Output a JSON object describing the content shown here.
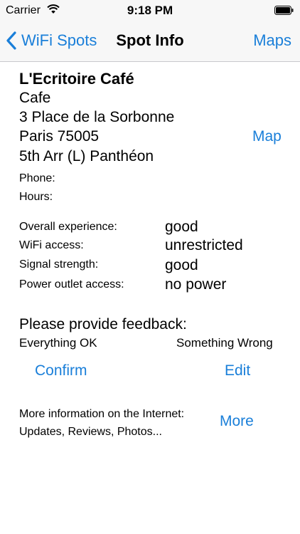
{
  "status_bar": {
    "carrier": "Carrier",
    "time": "9:18 PM"
  },
  "nav": {
    "back_label": "WiFi Spots",
    "title": "Spot Info",
    "right_label": "Maps"
  },
  "spot": {
    "name": "L'Ecritoire Café",
    "type": "Cafe",
    "street": "3 Place de la Sorbonne",
    "city": "Paris 75005",
    "district": " 5th Arr (L) Panthéon",
    "map_link": "Map",
    "phone_label": "Phone:",
    "hours_label": "Hours:"
  },
  "ratings": [
    {
      "label": "Overall experience:",
      "value": "good"
    },
    {
      "label": "WiFi access:",
      "value": "unrestricted"
    },
    {
      "label": "Signal strength:",
      "value": "good"
    },
    {
      "label": "Power outlet access:",
      "value": "no power"
    }
  ],
  "feedback": {
    "title": "Please provide feedback:",
    "option_ok": "Everything OK",
    "option_wrong": "Something Wrong",
    "confirm_label": "Confirm",
    "edit_label": "Edit"
  },
  "more_info": {
    "line1": "More information on the Internet:",
    "line2": "Updates, Reviews, Photos...",
    "more_label": "More"
  },
  "colors": {
    "accent": "#1a7fd9",
    "bar_background": "#f7f7f7"
  }
}
